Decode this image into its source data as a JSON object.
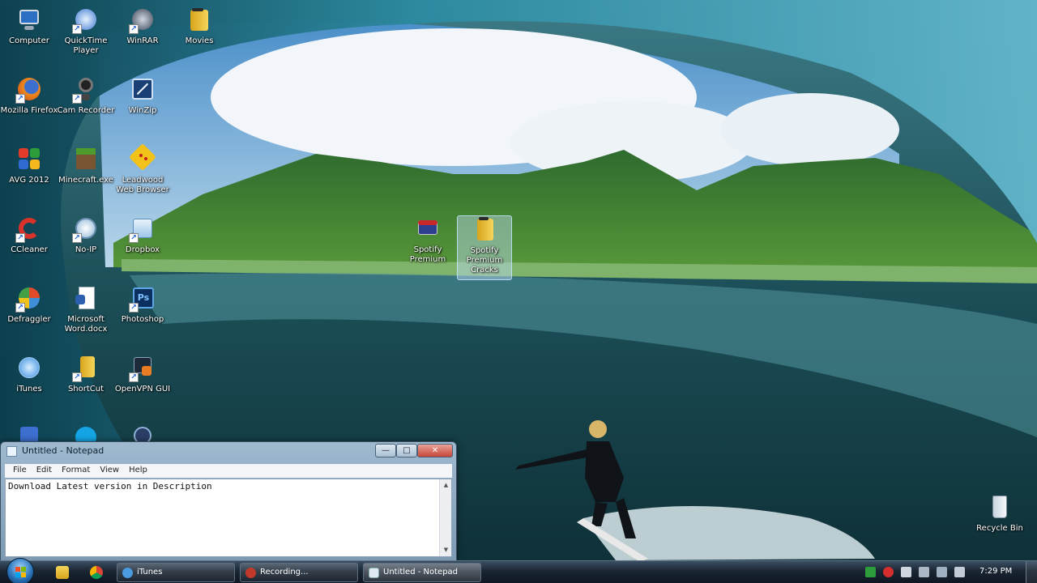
{
  "desktop": {
    "icons": [
      {
        "label": "Computer",
        "art": "computer-icon"
      },
      {
        "label": "QuickTime Player",
        "art": "quicktime-icon"
      },
      {
        "label": "WinRAR",
        "art": "winrar-icon"
      },
      {
        "label": "Movies",
        "art": "folder-icon"
      },
      {
        "label": "Mozilla Firefox",
        "art": "firefox-icon"
      },
      {
        "label": "Cam Recorder",
        "art": "webcam-icon"
      },
      {
        "label": "WinZip",
        "art": "winzip-icon"
      },
      {
        "label": "AVG 2012",
        "art": "avg-icon"
      },
      {
        "label": "Minecraft.exe",
        "art": "minecraft-icon"
      },
      {
        "label": "Leadwood Web Browser",
        "art": "browser-icon"
      },
      {
        "label": "CCleaner",
        "art": "ccleaner-icon"
      },
      {
        "label": "No-IP",
        "art": "noip-icon"
      },
      {
        "label": "Dropbox",
        "art": "dropbox-icon"
      },
      {
        "label": "Spotify Premium",
        "art": "spotify-installer-icon"
      },
      {
        "label": "Spotify Premium Cracks",
        "art": "folder-icon"
      },
      {
        "label": "Defraggler",
        "art": "defraggler-icon"
      },
      {
        "label": "Microsoft Word.docx",
        "art": "word-doc-icon"
      },
      {
        "label": "Photoshop",
        "art": "photoshop-icon"
      },
      {
        "label": "iTunes",
        "art": "itunes-icon"
      },
      {
        "label": "ShortCut",
        "art": "shortcut-icon"
      },
      {
        "label": "OpenVPN GUI",
        "art": "openvpn-icon"
      },
      {
        "label": "Recycle Bin",
        "art": "recycle-bin-icon"
      }
    ]
  },
  "notepad": {
    "title": "Untitled - Notepad",
    "menu": [
      "File",
      "Edit",
      "Format",
      "View",
      "Help"
    ],
    "content": "Download Latest version in Description",
    "buttons": {
      "minimize": "—",
      "maximize": "□",
      "close": "✕"
    }
  },
  "taskbar": {
    "buttons": [
      {
        "label": "iTunes",
        "color": "#4a9be0"
      },
      {
        "label": "Recording...",
        "color": "#c0392b"
      },
      {
        "label": "Untitled - Notepad",
        "color": "#dfe9f2"
      }
    ],
    "clock": "7:29 PM"
  }
}
